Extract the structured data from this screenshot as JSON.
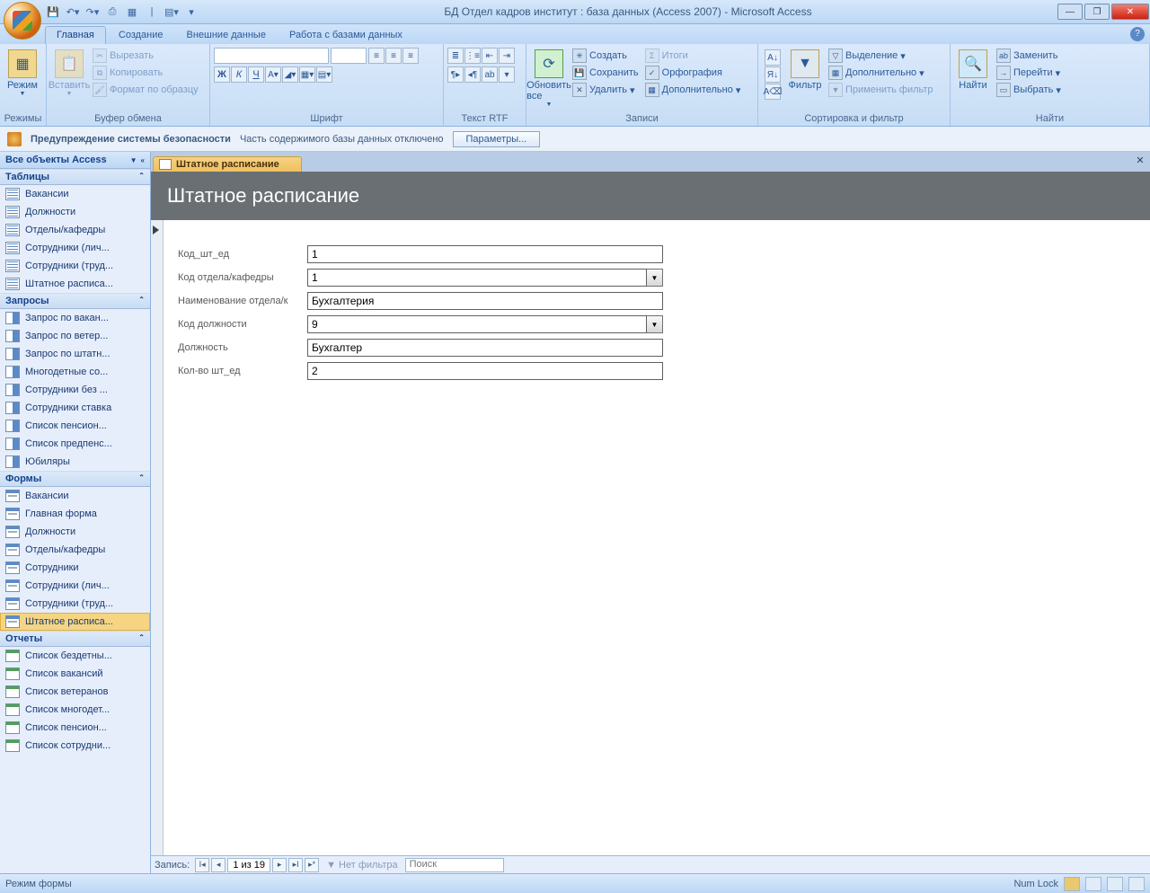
{
  "title": "БД Отдел кадров институт : база данных (Access 2007) - Microsoft Access",
  "ribbon_tabs": [
    "Главная",
    "Создание",
    "Внешние данные",
    "Работа с базами данных"
  ],
  "ribbon": {
    "modes": {
      "view": "Режим",
      "label": "Режимы"
    },
    "clipboard": {
      "paste": "Вставить",
      "cut": "Вырезать",
      "copy": "Копировать",
      "format": "Формат по образцу",
      "label": "Буфер обмена"
    },
    "font": {
      "label": "Шрифт"
    },
    "richtext": {
      "label": "Текст RTF"
    },
    "records": {
      "refresh": "Обновить все",
      "new": "Создать",
      "save": "Сохранить",
      "delete": "Удалить",
      "totals": "Итоги",
      "spell": "Орфография",
      "more": "Дополнительно",
      "label": "Записи"
    },
    "sortfilter": {
      "filter": "Фильтр",
      "selection": "Выделение",
      "advanced": "Дополнительно",
      "toggle": "Применить фильтр",
      "label": "Сортировка и фильтр"
    },
    "find": {
      "find": "Найти",
      "replace": "Заменить",
      "goto": "Перейти",
      "select": "Выбрать",
      "label": "Найти"
    }
  },
  "security": {
    "title": "Предупреждение системы безопасности",
    "msg": "Часть содержимого базы данных отключено",
    "btn": "Параметры..."
  },
  "nav": {
    "title": "Все объекты Access",
    "groups": [
      {
        "name": "Таблицы",
        "items": [
          "Вакансии",
          "Должности",
          "Отделы/кафедры",
          "Сотрудники (лич...",
          "Сотрудники (труд...",
          "Штатное расписа..."
        ],
        "type": "tbl"
      },
      {
        "name": "Запросы",
        "items": [
          "Запрос по вакан...",
          "Запрос по ветер...",
          "Запрос по штатн...",
          "Многодетные со...",
          "Сотрудники без ...",
          "Сотрудники ставка",
          "Список пенсион...",
          "Список предпенс...",
          "Юбиляры"
        ],
        "type": "qry"
      },
      {
        "name": "Формы",
        "items": [
          "Вакансии",
          "Главная форма",
          "Должности",
          "Отделы/кафедры",
          "Сотрудники",
          "Сотрудники (лич...",
          "Сотрудники (труд...",
          "Штатное расписа..."
        ],
        "type": "frm",
        "selected": 7
      },
      {
        "name": "Отчеты",
        "items": [
          "Список бездетны...",
          "Список вакансий",
          "Список ветеранов",
          "Список многодет...",
          "Список пенсион...",
          "Список сотрудни..."
        ],
        "type": "rpt"
      }
    ]
  },
  "doc": {
    "tab": "Штатное расписание",
    "header": "Штатное расписание",
    "fields": [
      {
        "label": "Код_шт_ед",
        "value": "1",
        "type": "text"
      },
      {
        "label": "Код отдела/кафедры",
        "value": "1",
        "type": "combo"
      },
      {
        "label": "Наименование отдела/к",
        "value": "Бухгалтерия",
        "type": "text"
      },
      {
        "label": "Код должности",
        "value": "9",
        "type": "combo"
      },
      {
        "label": "Должность",
        "value": "Бухгалтер",
        "type": "text"
      },
      {
        "label": "Кол-во шт_ед",
        "value": "2",
        "type": "text"
      }
    ]
  },
  "recnav": {
    "label": "Запись:",
    "pos": "1 из 19",
    "filter": "Нет фильтра",
    "search": "Поиск"
  },
  "status": {
    "mode": "Режим формы",
    "numlock": "Num Lock"
  }
}
